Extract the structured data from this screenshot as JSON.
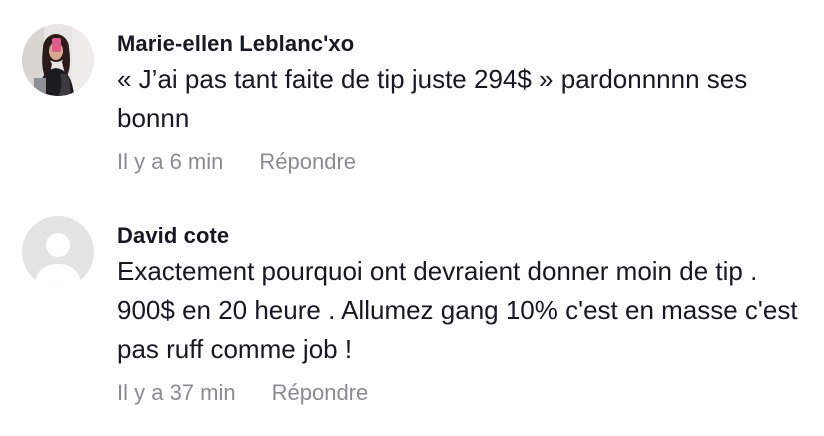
{
  "comments": [
    {
      "username": "Marie-ellen Leblanc'xo",
      "text": "« J’ai pas tant faite de tip juste 294$ » pardonnnnn ses bonnn",
      "time": "Il y a 6 min",
      "reply_label": "Répondre",
      "avatar": "photo-avatar"
    },
    {
      "username": "David cote",
      "text": "Exactement pourquoi ont devraient donner moin de tip . 900$ en 20 heure . Allumez gang 10% c'est en masse c'est pas ruff comme job !",
      "time": "Il y a 37 min",
      "reply_label": "Répondre",
      "avatar": "default-user-icon"
    }
  ]
}
